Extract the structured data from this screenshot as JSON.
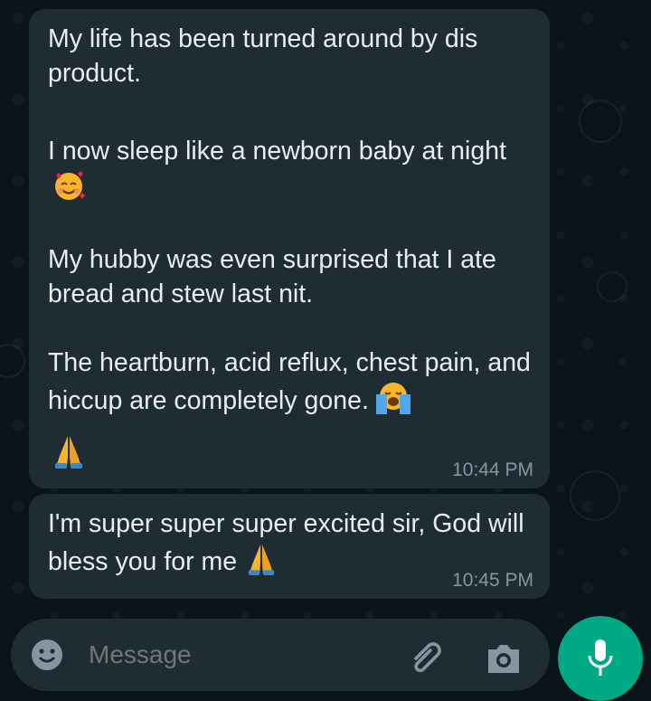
{
  "messages": [
    {
      "paragraphs": [
        "My life has been turned around by dis product.",
        "I now sleep like a newborn baby at night",
        "My hubby was even surprised that I ate bread and stew last nit.",
        "The heartburn, acid reflux, chest pain, and hiccup are completely gone."
      ],
      "emojis": [
        "smiling-face-with-hearts",
        "loudly-crying-face",
        "folded-hands"
      ],
      "time": "10:44 PM"
    },
    {
      "text": "I'm super super super excited sir, God will bless you for me",
      "emojis": [
        "folded-hands"
      ],
      "time": "10:45 PM"
    }
  ],
  "composer": {
    "placeholder": "Message",
    "icons": [
      "emoji-icon",
      "attach-icon",
      "camera-icon"
    ]
  },
  "mic_icon": "mic-icon",
  "colors": {
    "background": "#0b141a",
    "bubble": "#202c33",
    "text": "#e9edef",
    "meta": "#8696a0",
    "accent": "#00a884"
  }
}
